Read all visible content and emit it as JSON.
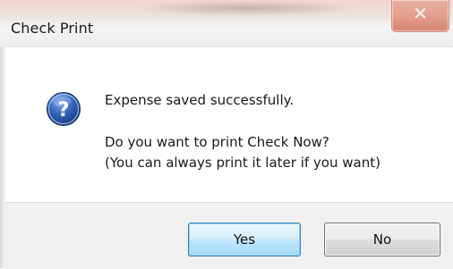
{
  "window": {
    "title": "Check Print",
    "close_glyph": "✕"
  },
  "message": {
    "icon": "question-icon",
    "line1": "Expense saved successfully.",
    "line2": "Do you want to print Check Now?",
    "line3": "(You can always print it later if you want)"
  },
  "buttons": {
    "yes_label": "Yes",
    "no_label": "No"
  },
  "colors": {
    "icon_blue": "#2f62b8",
    "close_red": "#e3a192",
    "default_button_border": "#3c7fb1"
  }
}
